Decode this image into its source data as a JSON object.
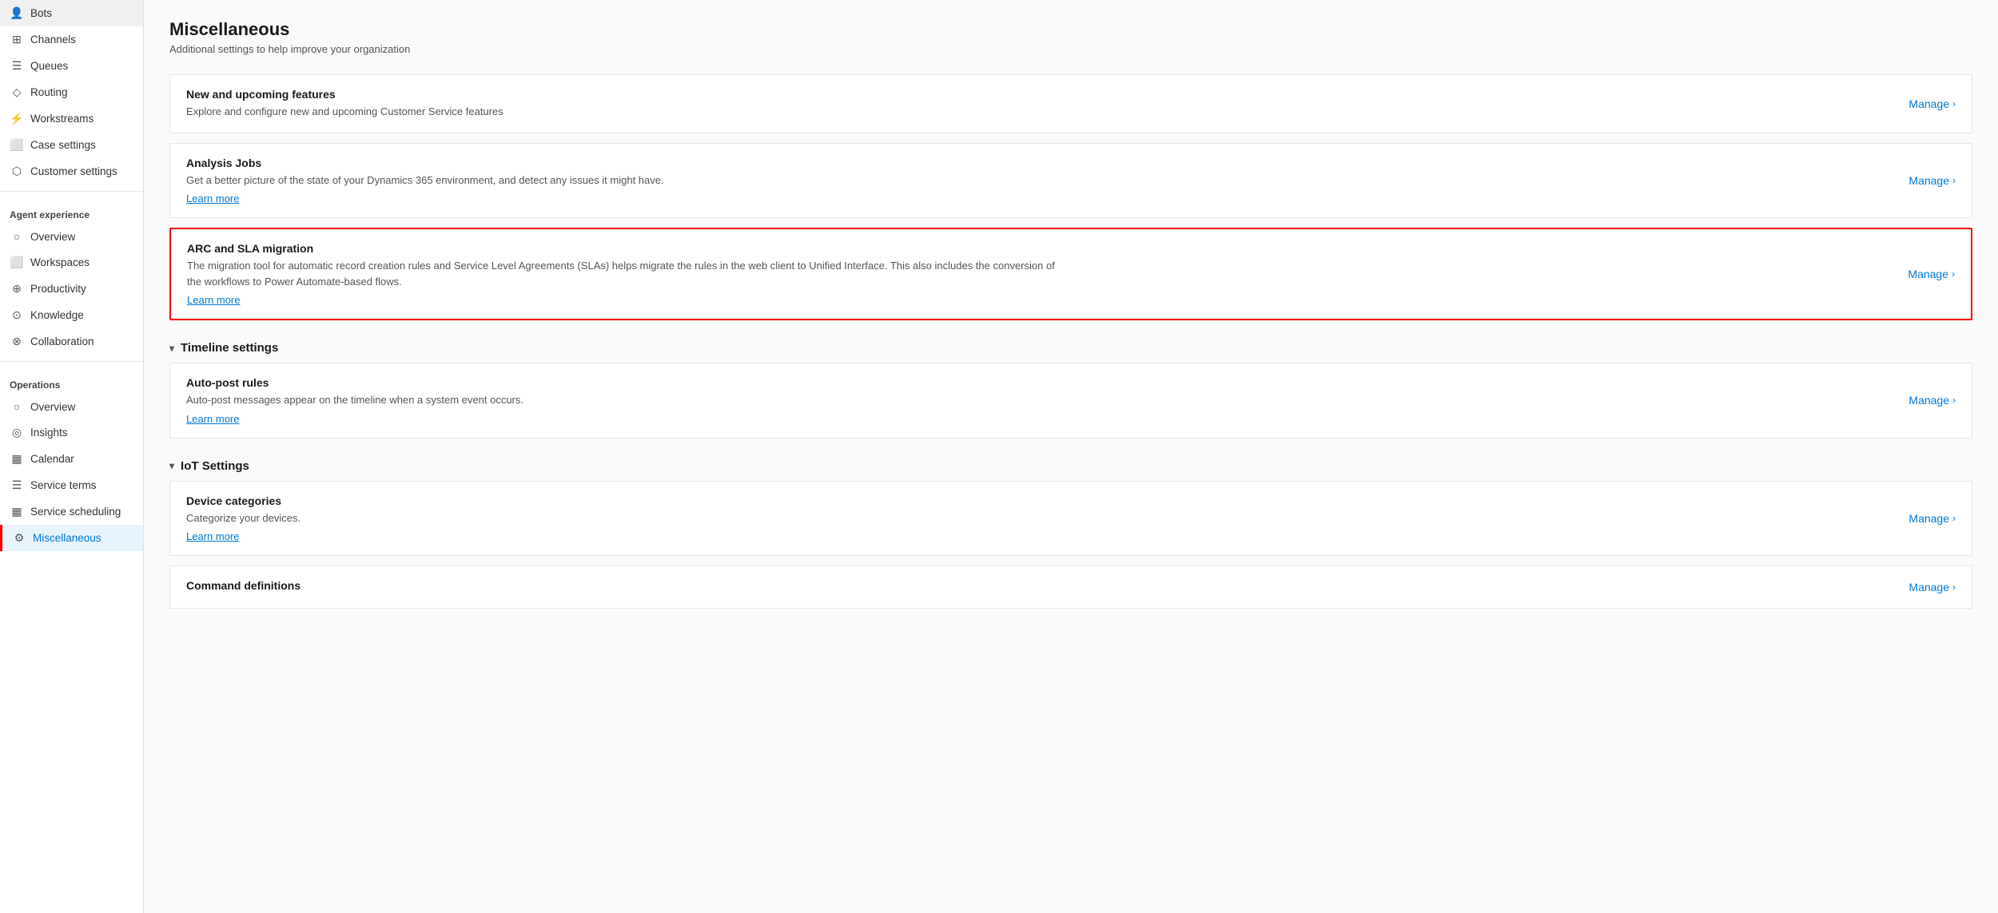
{
  "sidebar": {
    "items_top": [
      {
        "id": "bots",
        "label": "Bots",
        "icon": "👤"
      },
      {
        "id": "channels",
        "label": "Channels",
        "icon": "⊞"
      },
      {
        "id": "queues",
        "label": "Queues",
        "icon": "☰"
      },
      {
        "id": "routing",
        "label": "Routing",
        "icon": "◇"
      },
      {
        "id": "workstreams",
        "label": "Workstreams",
        "icon": "⚡"
      },
      {
        "id": "case-settings",
        "label": "Case settings",
        "icon": "⬜"
      },
      {
        "id": "customer-settings",
        "label": "Customer settings",
        "icon": "⬡"
      }
    ],
    "agent_experience_label": "Agent experience",
    "agent_experience_items": [
      {
        "id": "ae-overview",
        "label": "Overview",
        "icon": "○"
      },
      {
        "id": "ae-workspaces",
        "label": "Workspaces",
        "icon": "⬜"
      },
      {
        "id": "ae-productivity",
        "label": "Productivity",
        "icon": "⊕"
      },
      {
        "id": "ae-knowledge",
        "label": "Knowledge",
        "icon": "⊙"
      },
      {
        "id": "ae-collaboration",
        "label": "Collaboration",
        "icon": "⊗"
      }
    ],
    "operations_label": "Operations",
    "operations_items": [
      {
        "id": "op-overview",
        "label": "Overview",
        "icon": "○"
      },
      {
        "id": "op-insights",
        "label": "Insights",
        "icon": "◎"
      },
      {
        "id": "op-calendar",
        "label": "Calendar",
        "icon": "▦"
      },
      {
        "id": "op-service-terms",
        "label": "Service terms",
        "icon": "☰"
      },
      {
        "id": "op-service-scheduling",
        "label": "Service scheduling",
        "icon": "▦"
      },
      {
        "id": "op-miscellaneous",
        "label": "Miscellaneous",
        "icon": "⚙",
        "active": true
      }
    ]
  },
  "main": {
    "page_title": "Miscellaneous",
    "page_subtitle": "Additional settings to help improve your organization",
    "cards": [
      {
        "id": "new-features",
        "title": "New and upcoming features",
        "description": "Explore and configure new and upcoming Customer Service features",
        "link": null,
        "highlighted": false
      },
      {
        "id": "analysis-jobs",
        "title": "Analysis Jobs",
        "description": "Get a better picture of the state of your Dynamics 365 environment, and detect any issues it might have.",
        "link": "Learn more",
        "highlighted": false
      },
      {
        "id": "arc-sla-migration",
        "title": "ARC and SLA migration",
        "description": "The migration tool for automatic record creation rules and Service Level Agreements (SLAs) helps migrate the rules in the web client to Unified Interface. This also includes the conversion of the workflows to Power Automate-based flows.",
        "link": "Learn more",
        "highlighted": true
      }
    ],
    "timeline_section": {
      "label": "Timeline settings",
      "cards": [
        {
          "id": "auto-post-rules",
          "title": "Auto-post rules",
          "description": "Auto-post messages appear on the timeline when a system event occurs.",
          "link": "Learn more",
          "highlighted": false
        }
      ]
    },
    "iot_section": {
      "label": "IoT Settings",
      "cards": [
        {
          "id": "device-categories",
          "title": "Device categories",
          "description": "Categorize your devices.",
          "link": "Learn more",
          "highlighted": false
        },
        {
          "id": "command-definitions",
          "title": "Command definitions",
          "description": "",
          "link": null,
          "highlighted": false
        }
      ]
    },
    "manage_label": "Manage",
    "learn_more_label": "Learn more"
  }
}
